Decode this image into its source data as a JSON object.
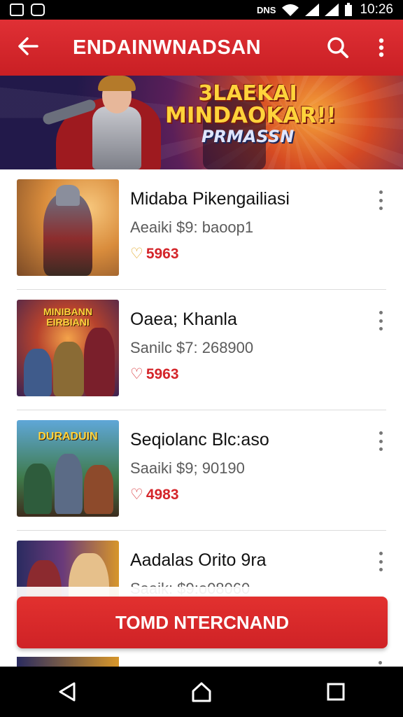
{
  "status_bar": {
    "time": "10:26",
    "net_label": "DNS"
  },
  "app_bar": {
    "title": "ENDAINWNADSAN"
  },
  "banner": {
    "line1": "3LAEKAI",
    "line2": "MINDAOKAR!!",
    "line3": "PRMASSN"
  },
  "games": [
    {
      "name": "Midaba Pikengailiasi",
      "meta": "Aeaiki $9: baoop1",
      "rating": "5963",
      "rating_icon": "thumb-icon",
      "thumb_logo": ""
    },
    {
      "name": "Oaea; Khanla",
      "meta": "Sanilc $7: 268900",
      "rating": "5963",
      "rating_icon": "heart-icon",
      "thumb_logo": "MINIBANN EIRBIANI"
    },
    {
      "name": "Seqiolanc Blc:aso",
      "meta": "Saaiki $9; 90190",
      "rating": "4983",
      "rating_icon": "thumb-icon",
      "thumb_logo": "DURADUIN"
    },
    {
      "name": "Aadalas Orito 9ra",
      "meta": "Saaik: $9:o08060",
      "rating": "",
      "rating_icon": "",
      "thumb_logo": ""
    }
  ],
  "cta": {
    "label": "TOMD NTERCNAND"
  },
  "colors": {
    "accent": "#d4252a",
    "nav": "#000000"
  }
}
